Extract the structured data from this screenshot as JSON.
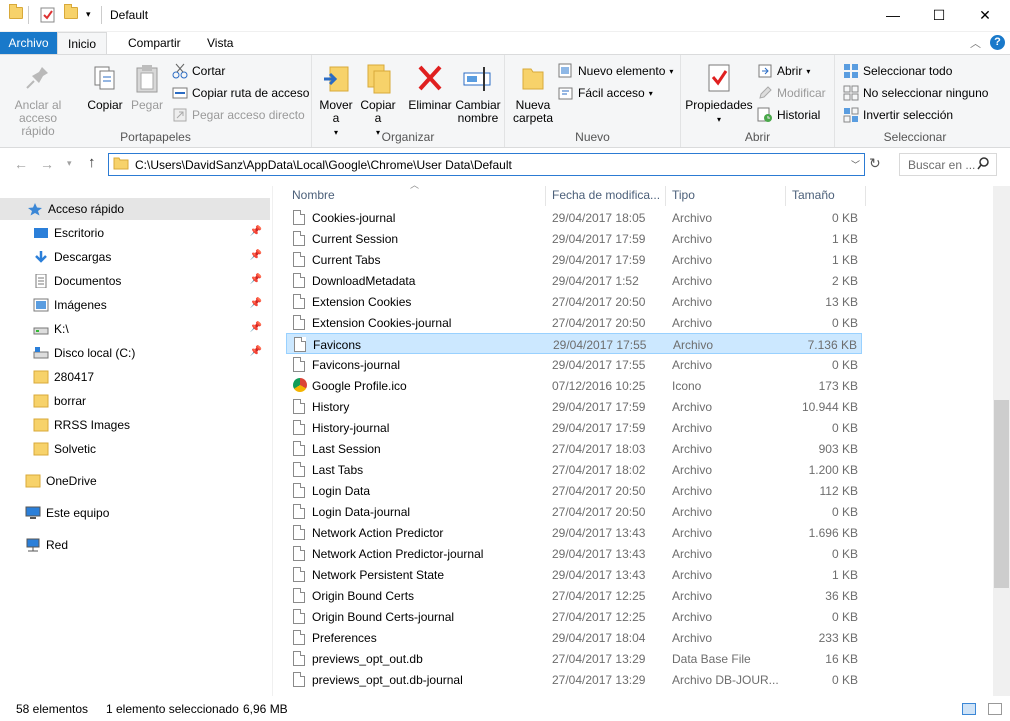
{
  "window": {
    "title": "Default",
    "minimize": "—",
    "maximize": "☐",
    "close": "✕"
  },
  "tabs": [
    {
      "label": "Archivo"
    },
    {
      "label": "Inicio"
    },
    {
      "label": "Compartir"
    },
    {
      "label": "Vista"
    }
  ],
  "ribbon": {
    "portapapeles": {
      "label": "Portapapeles",
      "anclar": "Anclar al acceso rápido",
      "copiar": "Copiar",
      "pegar": "Pegar",
      "cortar": "Cortar",
      "copiar_ruta": "Copiar ruta de acceso",
      "pegar_acceso": "Pegar acceso directo"
    },
    "organizar": {
      "label": "Organizar",
      "mover": "Mover a",
      "copiar": "Copiar a",
      "eliminar": "Eliminar",
      "cambiar": "Cambiar nombre"
    },
    "nuevo": {
      "label": "Nuevo",
      "nueva_carpeta": "Nueva carpeta",
      "nuevo_elemento": "Nuevo elemento",
      "facil_acceso": "Fácil acceso"
    },
    "abrir": {
      "label": "Abrir",
      "propiedades": "Propiedades",
      "abrir": "Abrir",
      "modificar": "Modificar",
      "historial": "Historial"
    },
    "seleccionar": {
      "label": "Seleccionar",
      "todo": "Seleccionar todo",
      "ninguno": "No seleccionar ninguno",
      "invertir": "Invertir selección"
    }
  },
  "address": {
    "path": "C:\\Users\\DavidSanz\\AppData\\Local\\Google\\Chrome\\User Data\\Default",
    "search_placeholder": "Buscar en ..."
  },
  "nav": {
    "quick_access": "Acceso rápido",
    "items": [
      {
        "label": "Escritorio"
      },
      {
        "label": "Descargas"
      },
      {
        "label": "Documentos"
      },
      {
        "label": "Imágenes"
      },
      {
        "label": "K:\\"
      },
      {
        "label": "Disco local (C:)"
      },
      {
        "label": "280417"
      },
      {
        "label": "borrar"
      },
      {
        "label": "RRSS Images"
      },
      {
        "label": "Solvetic"
      }
    ],
    "onedrive": "OneDrive",
    "este_equipo": "Este equipo",
    "red": "Red"
  },
  "columns": {
    "name": "Nombre",
    "date": "Fecha de modifica...",
    "type": "Tipo",
    "size": "Tamaño"
  },
  "files": [
    {
      "name": "Cookies-journal",
      "date": "29/04/2017 18:05",
      "type": "Archivo",
      "size": "0 KB"
    },
    {
      "name": "Current Session",
      "date": "29/04/2017 17:59",
      "type": "Archivo",
      "size": "1 KB"
    },
    {
      "name": "Current Tabs",
      "date": "29/04/2017 17:59",
      "type": "Archivo",
      "size": "1 KB"
    },
    {
      "name": "DownloadMetadata",
      "date": "29/04/2017 1:52",
      "type": "Archivo",
      "size": "2 KB"
    },
    {
      "name": "Extension Cookies",
      "date": "27/04/2017 20:50",
      "type": "Archivo",
      "size": "13 KB"
    },
    {
      "name": "Extension Cookies-journal",
      "date": "27/04/2017 20:50",
      "type": "Archivo",
      "size": "0 KB"
    },
    {
      "name": "Favicons",
      "date": "29/04/2017 17:55",
      "type": "Archivo",
      "size": "7.136 KB"
    },
    {
      "name": "Favicons-journal",
      "date": "29/04/2017 17:55",
      "type": "Archivo",
      "size": "0 KB"
    },
    {
      "name": "Google Profile.ico",
      "date": "07/12/2016 10:25",
      "type": "Icono",
      "size": "173 KB"
    },
    {
      "name": "History",
      "date": "29/04/2017 17:59",
      "type": "Archivo",
      "size": "10.944 KB"
    },
    {
      "name": "History-journal",
      "date": "29/04/2017 17:59",
      "type": "Archivo",
      "size": "0 KB"
    },
    {
      "name": "Last Session",
      "date": "27/04/2017 18:03",
      "type": "Archivo",
      "size": "903 KB"
    },
    {
      "name": "Last Tabs",
      "date": "27/04/2017 18:02",
      "type": "Archivo",
      "size": "1.200 KB"
    },
    {
      "name": "Login Data",
      "date": "27/04/2017 20:50",
      "type": "Archivo",
      "size": "112 KB"
    },
    {
      "name": "Login Data-journal",
      "date": "27/04/2017 20:50",
      "type": "Archivo",
      "size": "0 KB"
    },
    {
      "name": "Network Action Predictor",
      "date": "29/04/2017 13:43",
      "type": "Archivo",
      "size": "1.696 KB"
    },
    {
      "name": "Network Action Predictor-journal",
      "date": "29/04/2017 13:43",
      "type": "Archivo",
      "size": "0 KB"
    },
    {
      "name": "Network Persistent State",
      "date": "29/04/2017 13:43",
      "type": "Archivo",
      "size": "1 KB"
    },
    {
      "name": "Origin Bound Certs",
      "date": "27/04/2017 12:25",
      "type": "Archivo",
      "size": "36 KB"
    },
    {
      "name": "Origin Bound Certs-journal",
      "date": "27/04/2017 12:25",
      "type": "Archivo",
      "size": "0 KB"
    },
    {
      "name": "Preferences",
      "date": "29/04/2017 18:04",
      "type": "Archivo",
      "size": "233 KB"
    },
    {
      "name": "previews_opt_out.db",
      "date": "27/04/2017 13:29",
      "type": "Data Base File",
      "size": "16 KB"
    },
    {
      "name": "previews_opt_out.db-journal",
      "date": "27/04/2017 13:29",
      "type": "Archivo DB-JOUR...",
      "size": "0 KB"
    }
  ],
  "status": {
    "count": "58 elementos",
    "selected": "1 elemento seleccionado",
    "size": "6,96 MB"
  }
}
